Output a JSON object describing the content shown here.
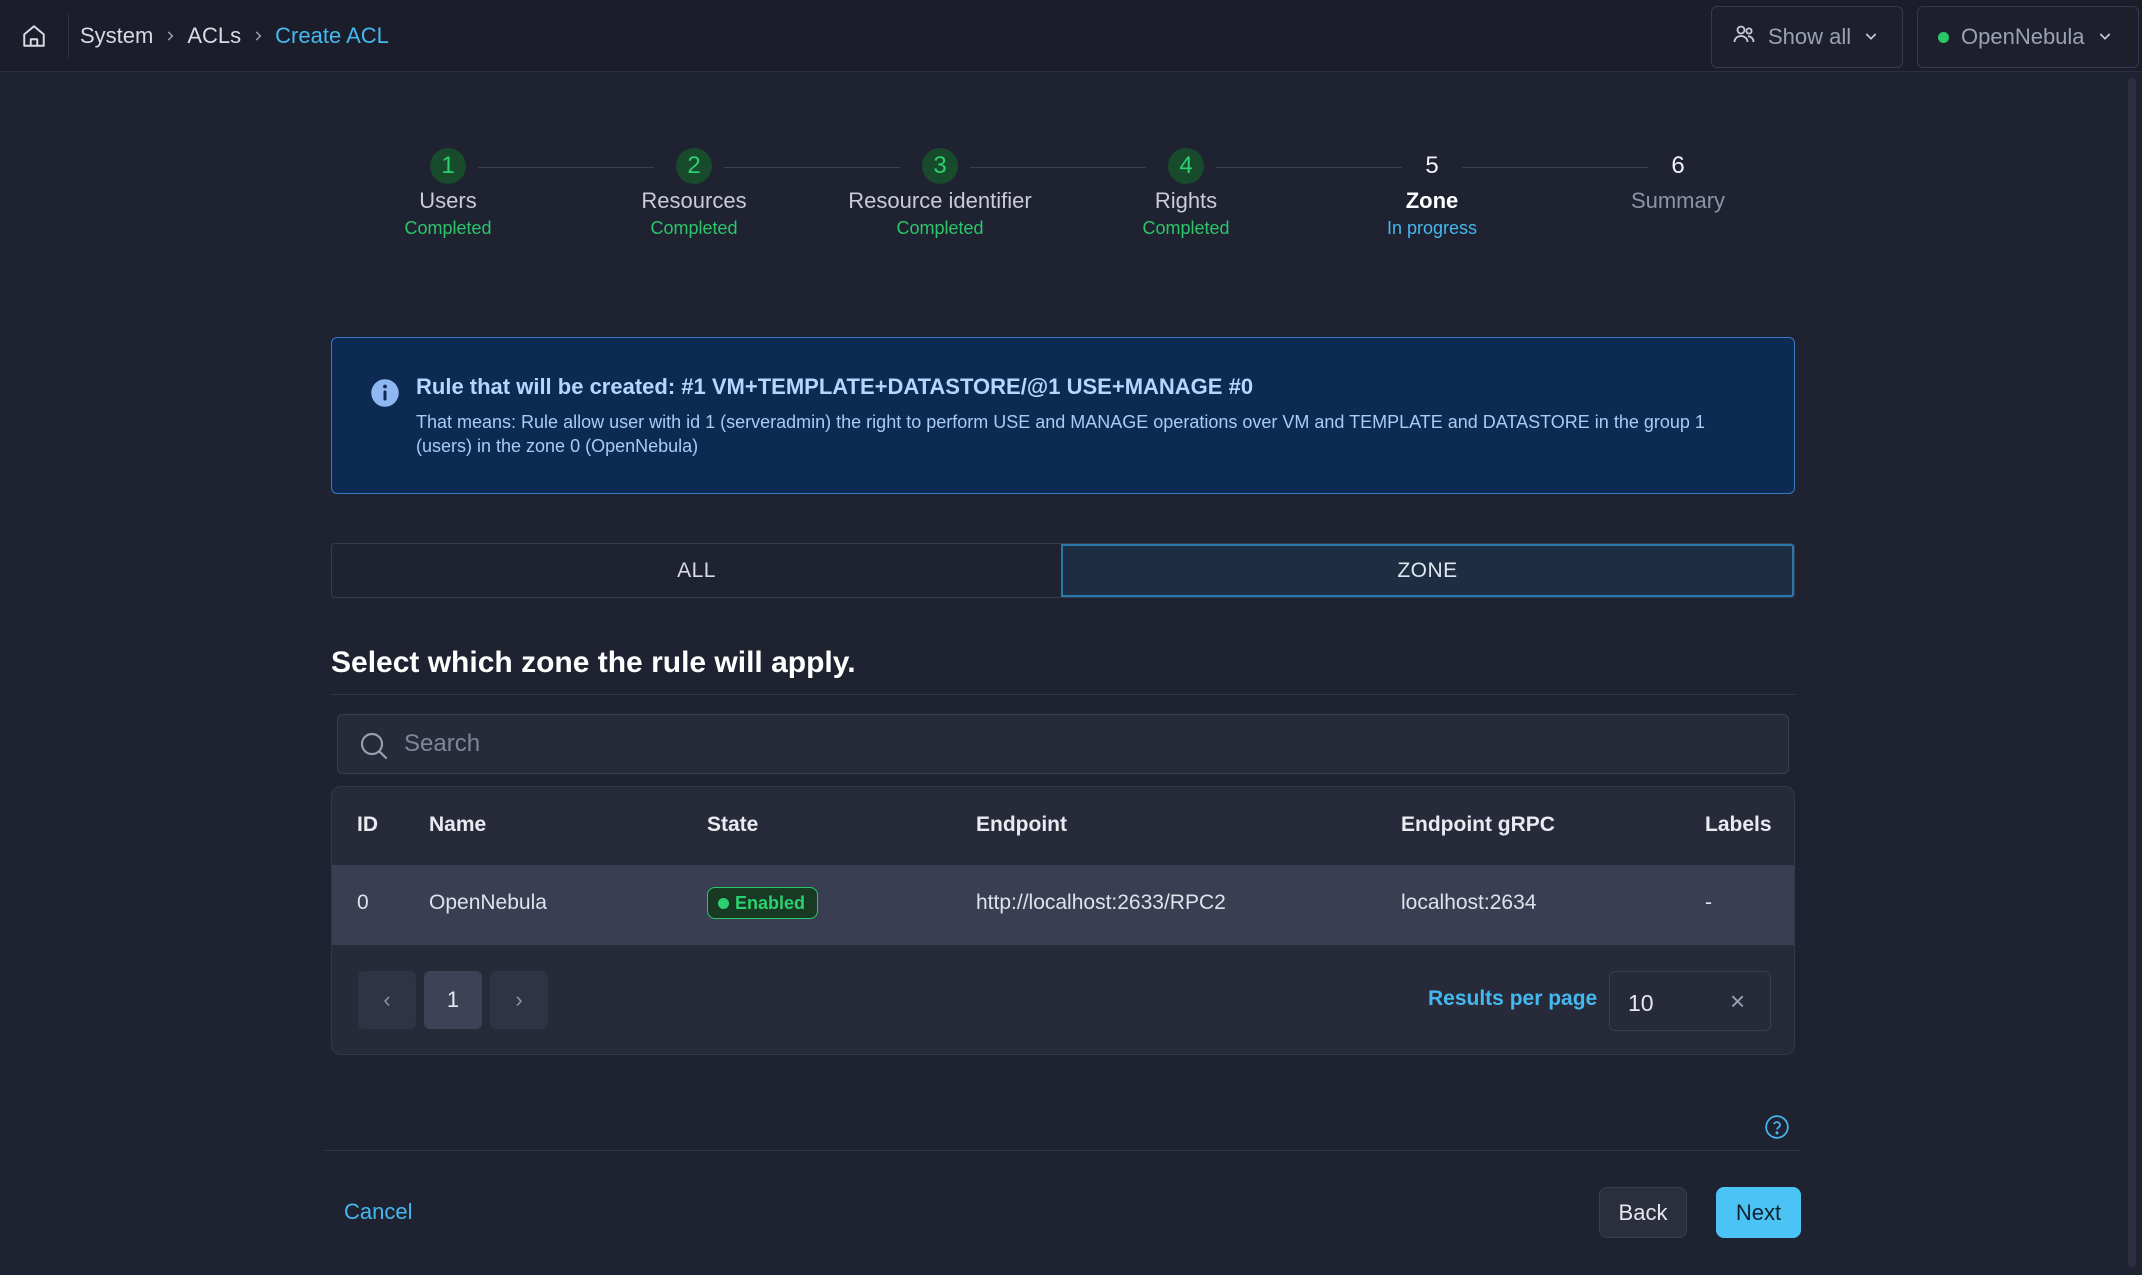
{
  "breadcrumb": {
    "items": [
      "System",
      "ACLs"
    ],
    "current": "Create ACL"
  },
  "header": {
    "group_filter": "Show all",
    "zone": "OpenNebula",
    "zone_status_color": "#2bc66a"
  },
  "stepper": {
    "steps": [
      {
        "number": "1",
        "label": "Users",
        "status": "Completed"
      },
      {
        "number": "2",
        "label": "Resources",
        "status": "Completed"
      },
      {
        "number": "3",
        "label": "Resource identifier",
        "status": "Completed"
      },
      {
        "number": "4",
        "label": "Rights",
        "status": "Completed"
      },
      {
        "number": "5",
        "label": "Zone",
        "status": "In progress"
      },
      {
        "number": "6",
        "label": "Summary",
        "status": ""
      }
    ]
  },
  "info": {
    "icon": "info-icon",
    "title": "Rule that will be created: #1 VM+TEMPLATE+DATASTORE/@1 USE+MANAGE #0",
    "text": "That means: Rule allow user with id 1 (serveradmin) the right to perform USE and MANAGE operations over VM and TEMPLATE and DATASTORE in the group 1 (users) in the zone 0 (OpenNebula)"
  },
  "tabs": {
    "all": "ALL",
    "zone": "ZONE",
    "selected": "ZONE"
  },
  "section": {
    "title": "Select which zone the rule will apply."
  },
  "search": {
    "placeholder": "Search",
    "value": ""
  },
  "table": {
    "columns": {
      "id": "ID",
      "name": "Name",
      "state": "State",
      "endpoint": "Endpoint",
      "endpoint_grpc": "Endpoint gRPC",
      "labels": "Labels"
    },
    "rows": [
      {
        "id": "0",
        "name": "OpenNebula",
        "state": "Enabled",
        "endpoint": "http://localhost:2633/RPC2",
        "endpoint_grpc": "localhost:2634",
        "labels": "-"
      }
    ]
  },
  "pagination": {
    "prev": "‹",
    "current_page": "1",
    "next": "›",
    "results_label": "Results per page",
    "results_value": "10",
    "clear": "×"
  },
  "footer": {
    "cancel": "Cancel",
    "back": "Back",
    "next": "Next"
  },
  "colors": {
    "accent": "#45b8ef",
    "success": "#2bc66a",
    "info_bg": "#0d2a52"
  }
}
